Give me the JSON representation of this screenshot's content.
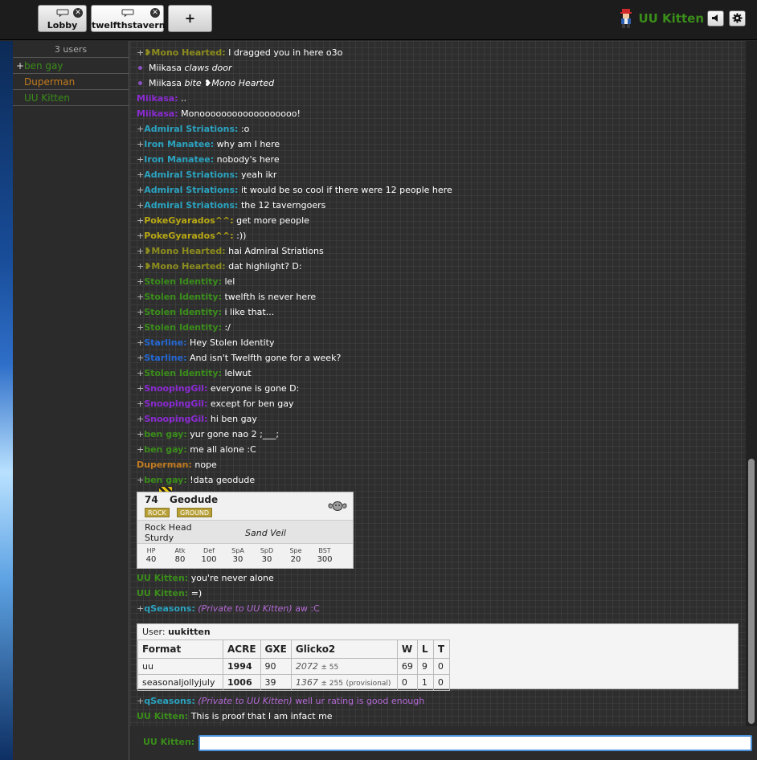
{
  "tabs": [
    {
      "label": "Lobby",
      "close": "✕"
    },
    {
      "label": "twelfthstavern",
      "close": "✕"
    }
  ],
  "add_tab": "+",
  "brand_user": "UU Kitten",
  "userlist": {
    "count": "3 users",
    "users": [
      {
        "rank": "+",
        "name": "ben gay",
        "color": "#3a8d1a"
      },
      {
        "rank": "",
        "name": "Duperman",
        "color": "#c17a1e"
      },
      {
        "rank": "",
        "name": "UU Kitten",
        "color": "#3a8d1a"
      }
    ]
  },
  "messages": [
    {
      "rank": "+",
      "name": "❥Mono Hearted:",
      "text": "I dragged you in here o3o",
      "color": "#8c8c1e",
      "type": "chat"
    },
    {
      "name": "Miikasa",
      "text": "claws door",
      "type": "emote"
    },
    {
      "name": "Miikasa",
      "text": "bite ❥Mono Hearted",
      "type": "emote"
    },
    {
      "rank": "",
      "name": "Miikasa:",
      "text": "..",
      "color": "#8a2ad2",
      "type": "chat"
    },
    {
      "rank": "",
      "name": "Miikasa:",
      "text": "Monoooooooooooooooooo!",
      "color": "#8a2ad2",
      "type": "chat"
    },
    {
      "rank": "+",
      "name": "Admiral Striations:",
      "text": ":o",
      "color": "#2aa3c0",
      "type": "chat"
    },
    {
      "rank": "+",
      "name": "Iron Manatee:",
      "text": "why am I here",
      "color": "#2aa3c0",
      "type": "chat"
    },
    {
      "rank": "+",
      "name": "Iron Manatee:",
      "text": "nobody's here",
      "color": "#2aa3c0",
      "type": "chat"
    },
    {
      "rank": "+",
      "name": "Admiral Striations:",
      "text": "yeah ikr",
      "color": "#2aa3c0",
      "type": "chat"
    },
    {
      "rank": "+",
      "name": "Admiral Striations:",
      "text": "it would be so cool if there were 12 people here",
      "color": "#2aa3c0",
      "type": "chat"
    },
    {
      "rank": "+",
      "name": "Admiral Striations:",
      "text": "the 12 taverngoers",
      "color": "#2aa3c0",
      "type": "chat"
    },
    {
      "rank": "+",
      "name": "PokeGyarados^^:",
      "text": "get more people",
      "color": "#b8a814",
      "type": "chat"
    },
    {
      "rank": "+",
      "name": "PokeGyarados^^:",
      "text": ":))",
      "color": "#b8a814",
      "type": "chat"
    },
    {
      "rank": "+",
      "name": "❥Mono Hearted:",
      "text": "hai Admiral Striations",
      "color": "#8c8c1e",
      "type": "chat"
    },
    {
      "rank": "+",
      "name": "❥Mono Hearted:",
      "text": "dat highlight? D:",
      "color": "#8c8c1e",
      "type": "chat"
    },
    {
      "rank": "+",
      "name": "Stolen Identity:",
      "text": "lel",
      "color": "#3a8d1a",
      "type": "chat"
    },
    {
      "rank": "+",
      "name": "Stolen Identity:",
      "text": "twelfth is never here",
      "color": "#3a8d1a",
      "type": "chat"
    },
    {
      "rank": "+",
      "name": "Stolen Identity:",
      "text": "i like that...",
      "color": "#3a8d1a",
      "type": "chat"
    },
    {
      "rank": "+",
      "name": "Stolen Identity:",
      "text": ":/",
      "color": "#3a8d1a",
      "type": "chat"
    },
    {
      "rank": "+",
      "name": "Starline:",
      "text": "Hey Stolen Identity",
      "color": "#2468d4",
      "type": "chat"
    },
    {
      "rank": "+",
      "name": "Starline:",
      "text": "And isn't Twelfth gone for a week?",
      "color": "#2468d4",
      "type": "chat"
    },
    {
      "rank": "+",
      "name": "Stolen Identity:",
      "text": "lelwut",
      "color": "#3a8d1a",
      "type": "chat"
    },
    {
      "rank": "+",
      "name": "SnoopingGil:",
      "text": "everyone is gone D:",
      "color": "#8a2ad2",
      "type": "chat"
    },
    {
      "rank": "+",
      "name": "SnoopingGil:",
      "text": "except for ben gay",
      "color": "#8a2ad2",
      "type": "chat"
    },
    {
      "rank": "+",
      "name": "SnoopingGil:",
      "text": "hi ben gay",
      "color": "#8a2ad2",
      "type": "chat"
    },
    {
      "rank": "+",
      "name": "ben gay:",
      "text": "yur gone nao 2 ;___;",
      "color": "#3a8d1a",
      "type": "chat"
    },
    {
      "rank": "+",
      "name": "ben gay:",
      "text": "me all alone :C",
      "color": "#3a8d1a",
      "type": "chat"
    },
    {
      "rank": "",
      "name": "Duperman:",
      "text": "nope",
      "color": "#c17a1e",
      "type": "chat"
    },
    {
      "rank": "+",
      "name": "ben gay:",
      "text": "!data geodude",
      "color": "#3a8d1a",
      "type": "chat"
    }
  ],
  "pokemon": {
    "num": "74",
    "name": "Geodude",
    "types": [
      "ROCK",
      "GROUND"
    ],
    "abilities": [
      "Rock Head",
      "Sturdy"
    ],
    "hidden": "Sand Veil",
    "stats": [
      {
        "label": "HP",
        "value": "40"
      },
      {
        "label": "Atk",
        "value": "80"
      },
      {
        "label": "Def",
        "value": "100"
      },
      {
        "label": "SpA",
        "value": "30"
      },
      {
        "label": "SpD",
        "value": "30"
      },
      {
        "label": "Spe",
        "value": "20"
      },
      {
        "label": "BST",
        "value": "300"
      }
    ]
  },
  "messages2": [
    {
      "rank": "",
      "name": "UU Kitten:",
      "text": "you're never alone",
      "color": "#3a8d1a",
      "type": "chat"
    },
    {
      "rank": "",
      "name": "UU Kitten:",
      "text": "=)",
      "color": "#3a8d1a",
      "type": "chat"
    },
    {
      "rank": "+",
      "name": "qSeasons:",
      "pm": "(Private to UU Kitten)",
      "text": "aw :C",
      "color": "#2aa3c0",
      "type": "pm"
    }
  ],
  "ranking": {
    "user_label": "User:",
    "user": "uukitten",
    "headers": [
      "Format",
      "ACRE",
      "GXE",
      "Glicko2",
      "W",
      "L",
      "T"
    ],
    "rows": [
      {
        "format": "uu",
        "acre": "1994",
        "gxe": "90",
        "glicko": "2072",
        "dev": "± 55",
        "prov": "",
        "w": "69",
        "l": "9",
        "t": "0"
      },
      {
        "format": "seasonaljollyjuly",
        "acre": "1006",
        "gxe": "39",
        "glicko": "1367",
        "dev": "± 255",
        "prov": "(provisional)",
        "w": "0",
        "l": "1",
        "t": "0"
      }
    ]
  },
  "messages3": [
    {
      "rank": "+",
      "name": "qSeasons:",
      "pm": "(Private to UU Kitten)",
      "text": "well ur rating is good enough",
      "color": "#2aa3c0",
      "type": "pm"
    },
    {
      "rank": "",
      "name": "UU Kitten:",
      "text": "This is proof that I am infact me",
      "color": "#3a8d1a",
      "type": "chat"
    }
  ],
  "input": {
    "user": "UU Kitten:",
    "value": ""
  },
  "colors": {
    "accent": "#4a90d9",
    "name_green": "#3a8d1a"
  }
}
